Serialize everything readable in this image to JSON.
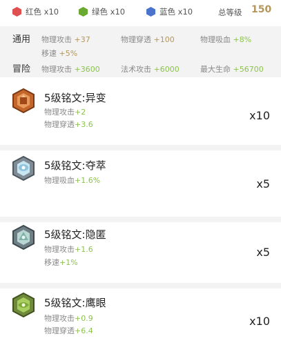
{
  "topbar": {
    "gems": [
      {
        "label": "红色 x10",
        "color": "#e05050",
        "icon": "red-hexagon-icon"
      },
      {
        "label": "绿色 x10",
        "color": "#6aaa32",
        "icon": "green-hexagon-icon"
      },
      {
        "label": "蓝色 x10",
        "color": "#4a74cc",
        "icon": "blue-hexagon-icon"
      }
    ],
    "level_label": "总等级",
    "level_value": "150"
  },
  "summary": {
    "general": {
      "label": "通用",
      "stats": [
        {
          "name": "物理攻击",
          "value": "+37"
        },
        {
          "name": "物理穿透",
          "value": "+100"
        },
        {
          "name": "物理吸血",
          "value": "+8%"
        },
        {
          "name": "移速",
          "value": "+5%"
        }
      ]
    },
    "adventure": {
      "label": "冒险",
      "stats": [
        {
          "name": "物理攻击",
          "value": "+3600"
        },
        {
          "name": "法术攻击",
          "value": "+6000"
        },
        {
          "name": "最大生命",
          "value": "+56700"
        }
      ]
    }
  },
  "runes": [
    {
      "name": "5级铭文:异变",
      "count": "x10",
      "icon": "red-rune-icon",
      "attrs": [
        {
          "name": "物理攻击",
          "value": "+2"
        },
        {
          "name": "物理穿透",
          "value": "+3.6"
        }
      ]
    },
    {
      "name": "5级铭文:夺萃",
      "count": "x5",
      "icon": "blue-rune-icon",
      "attrs": [
        {
          "name": "物理吸血",
          "value": "+1.6%"
        }
      ]
    },
    {
      "name": "5级铭文:隐匿",
      "count": "x5",
      "icon": "teal-rune-icon",
      "attrs": [
        {
          "name": "物理攻击",
          "value": "+1.6"
        },
        {
          "name": "移速",
          "value": "+1%"
        }
      ]
    },
    {
      "name": "5级铭文:鹰眼",
      "count": "x10",
      "icon": "green-rune-icon",
      "attrs": [
        {
          "name": "物理攻击",
          "value": "+0.9"
        },
        {
          "name": "物理穿透",
          "value": "+6.4"
        }
      ]
    }
  ]
}
